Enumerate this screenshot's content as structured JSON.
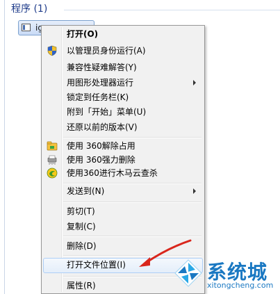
{
  "section": {
    "header": "程序 (1)"
  },
  "program": {
    "name": "ig"
  },
  "menu": {
    "items": [
      {
        "label": "打开(O)"
      },
      {
        "label": "以管理员身份运行(A)"
      },
      {
        "label": "兼容性疑难解答(Y)"
      },
      {
        "label": "用图形处理器运行"
      },
      {
        "label": "锁定到任务栏(K)"
      },
      {
        "label": "附到「开始」菜单(U)"
      },
      {
        "label": "还原以前的版本(V)"
      },
      {
        "label": "使用 360解除占用"
      },
      {
        "label": "使用 360强力删除"
      },
      {
        "label": "使用360进行木马云查杀"
      },
      {
        "label": "发送到(N)"
      },
      {
        "label": "剪切(T)"
      },
      {
        "label": "复制(C)"
      },
      {
        "label": "删除(D)"
      },
      {
        "label": "打开文件位置(I)"
      },
      {
        "label": "属性(R)"
      }
    ]
  },
  "icons": {
    "shield": "shield-icon",
    "unlock360": "360-unlock-icon",
    "delete360": "360-shred-icon",
    "scan360": "360-scan-icon"
  },
  "colors": {
    "accent": "#1e3b8a",
    "highlight": "#aecff7",
    "annotation": "#d9261c",
    "watermark": "#1a78c2"
  },
  "watermark": {
    "name": "系统城",
    "domain": "xitongcheng.com"
  }
}
